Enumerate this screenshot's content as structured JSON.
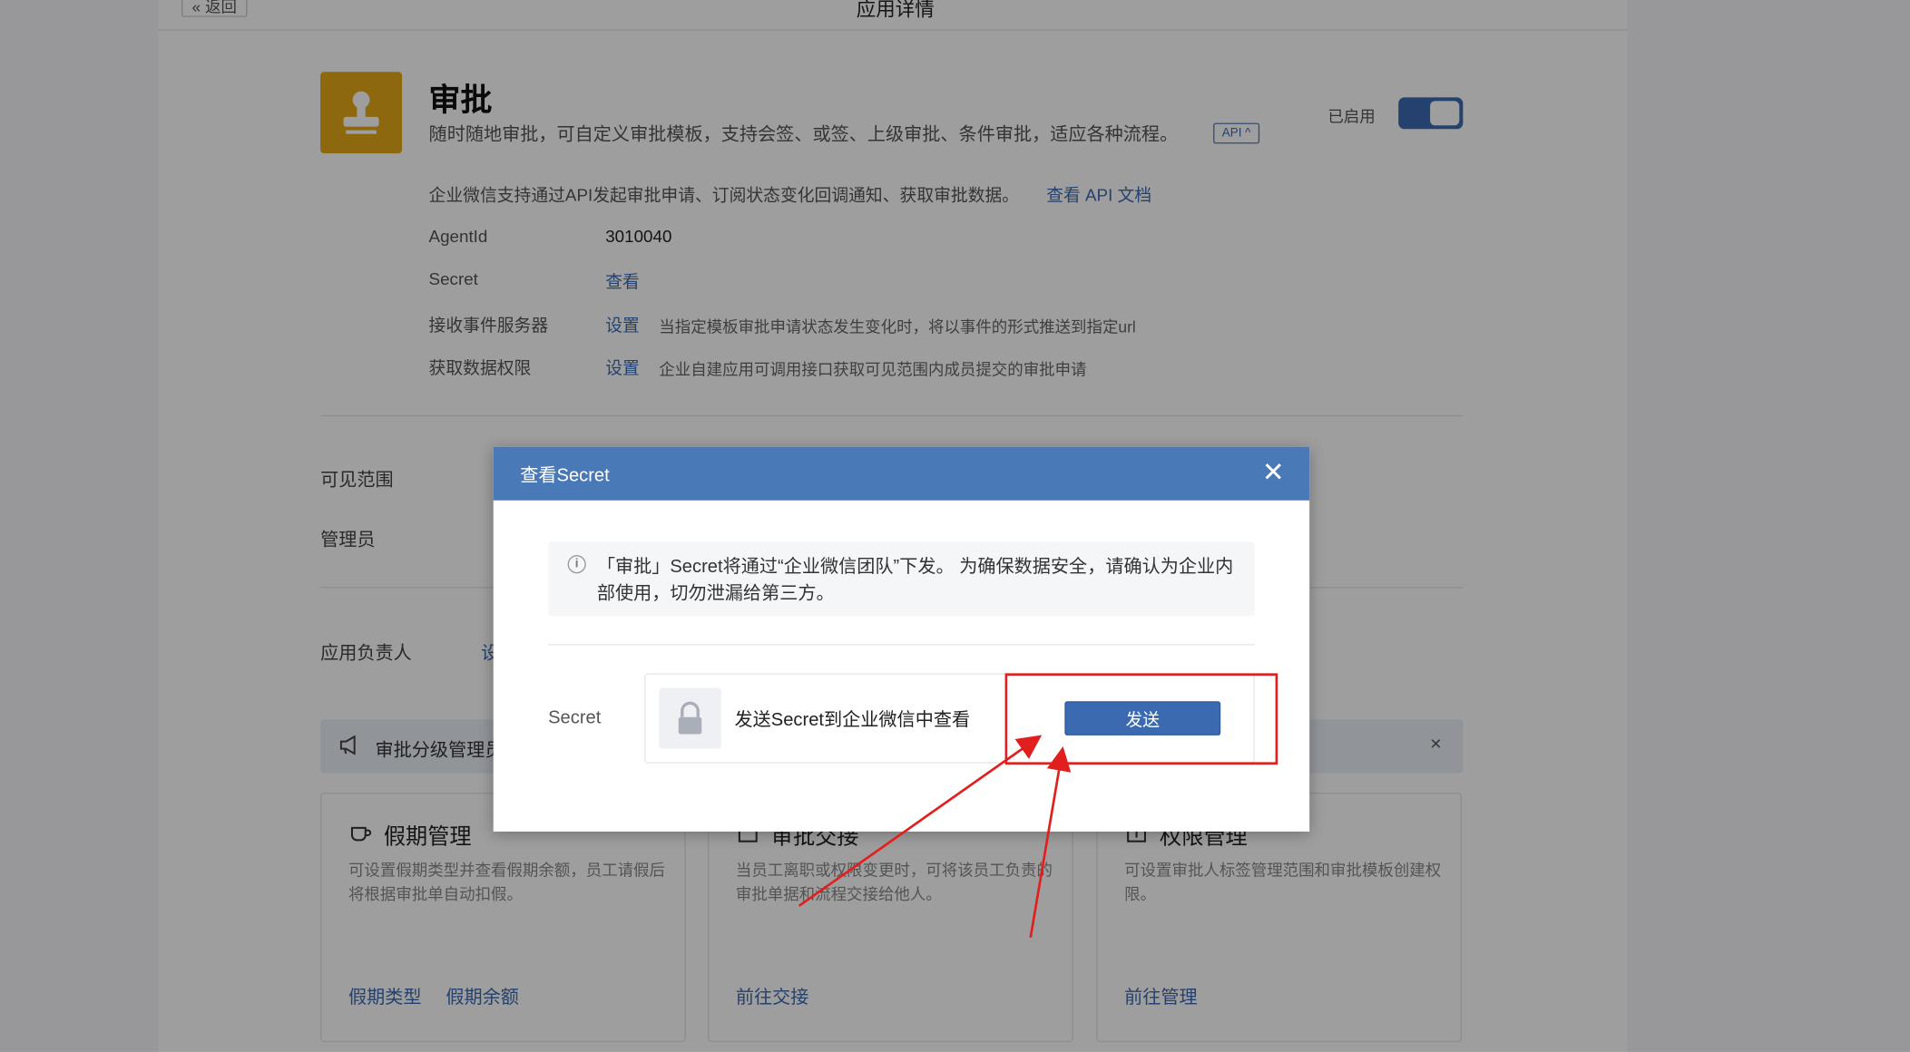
{
  "topbar": {
    "back_label": "« 返回",
    "title": "应用详情"
  },
  "app": {
    "name": "审批",
    "description": "随时随地审批，可自定义审批模板，支持会签、或签、上级审批、条件审批，适应各种流程。",
    "api_badge": "API ^",
    "enabled_label": "已启用",
    "enabled": true,
    "icon": "stamp-icon",
    "icon_color": "#e6a817"
  },
  "api_section": {
    "intro": "企业微信支持通过API发起审批申请、订阅状态变化回调通知、获取审批数据。",
    "doc_link": "查看 API 文档",
    "rows": [
      {
        "label": "AgentId",
        "value": "3010040"
      },
      {
        "label": "Secret",
        "link": "查看"
      },
      {
        "label": "接收事件服务器",
        "link": "设置",
        "desc": "当指定模板审批申请状态发生变化时，将以事件的形式推送到指定url"
      },
      {
        "label": "获取数据权限",
        "link": "设置",
        "desc": "企业自建应用可调用接口获取可见范围内成员提交的审批申请"
      }
    ]
  },
  "settings": {
    "visible_range_label": "可见范围",
    "admin_label": "管理员",
    "owner_label": "应用负责人",
    "owner_link_peek": "设"
  },
  "notice": {
    "text": "审批分级管理员",
    "close": "×"
  },
  "cards": [
    {
      "icon": "cup-icon",
      "title": "假期管理",
      "desc": "可设置假期类型并查看假期余额，员工请假后将根据审批单自动扣假。",
      "links": [
        "假期类型",
        "假期余额"
      ]
    },
    {
      "icon": "handover-icon",
      "title": "审批交接",
      "desc": "当员工离职或权限变更时，可将该员工负责的审批单据和流程交接给他人。",
      "links": [
        "前往交接"
      ]
    },
    {
      "icon": "permission-icon",
      "title": "权限管理",
      "desc": "可设置审批人标签管理范围和审批模板创建权限。",
      "links": [
        "前往管理"
      ]
    }
  ],
  "modal": {
    "title": "查看Secret",
    "close": "✕",
    "info": "「审批」Secret将通过“企业微信团队”下发。 为确保数据安全，请确认为企业内部使用，切勿泄漏给第三方。",
    "secret_label": "Secret",
    "secret_text": "发送Secret到企业微信中查看",
    "send_button": "发送",
    "lock_icon": "lock-icon"
  },
  "colors": {
    "accent": "#3c6ab1",
    "modal_header": "#4a79b8",
    "annotation": "#e21f1f"
  }
}
